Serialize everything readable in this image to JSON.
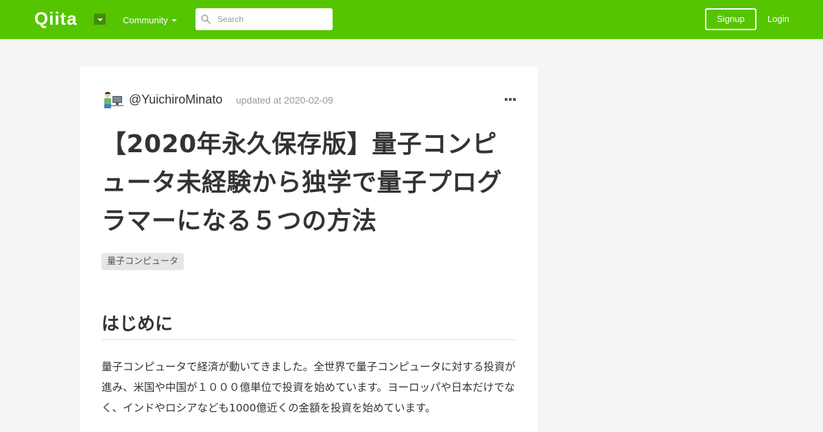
{
  "header": {
    "logo_text": "Qiita",
    "community_label": "Community",
    "search": {
      "placeholder": "Search",
      "value": ""
    },
    "signup_label": "Signup",
    "login_label": "Login",
    "colors": {
      "brand": "#55c500",
      "brand_dark": "#3f8f00"
    }
  },
  "article": {
    "author": "@YuichiroMinato",
    "updated_label": "updated at",
    "updated_date": "2020-02-09",
    "title": "【2020年永久保存版】量子コンピュータ未経験から独学で量子プログラマーになる５つの方法",
    "tags": [
      "量子コンピュータ"
    ],
    "section_heading": "はじめに",
    "paragraph": "量子コンピュータで経済が動いてきました。全世界で量子コンピュータに対する投資が進み、米国や中国が１０００億単位で投資を始めています。ヨーロッパや日本だけでなく、インドやロシアなども1000億近くの金額を投資を始めています。"
  },
  "icons": {
    "logo_menu": "chevron-down-icon",
    "search": "search-icon",
    "more": "ellipsis-icon",
    "avatar": "avatar"
  }
}
